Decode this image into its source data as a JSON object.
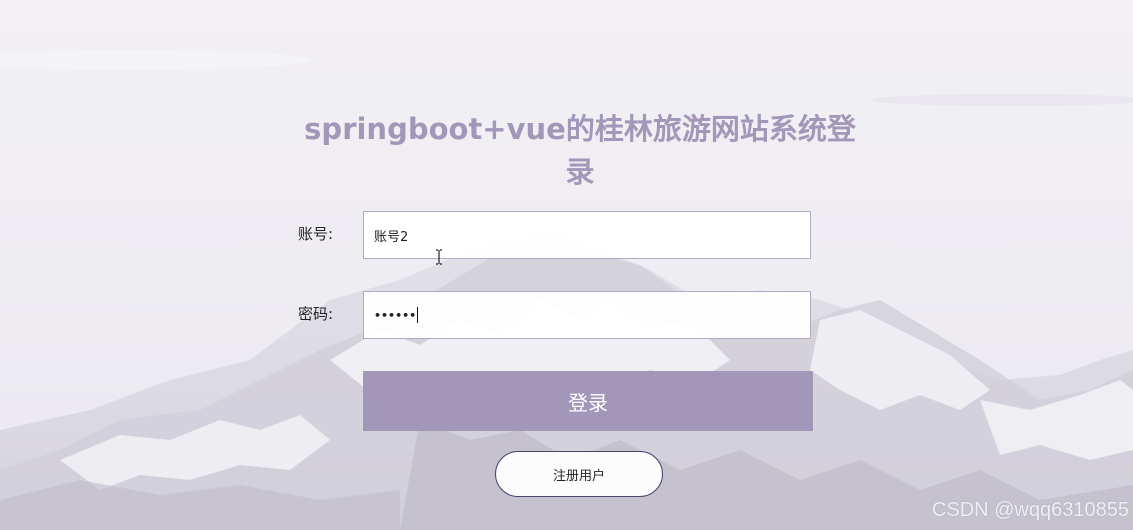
{
  "page": {
    "title": "springboot+vue的桂林旅游网站系统登录"
  },
  "form": {
    "username_label": "账号:",
    "username_value": "账号2",
    "password_label": "密码:",
    "password_value": "••••••",
    "login_label": "登录",
    "register_label": "注册用户"
  },
  "watermark": {
    "text": "CSDN @wqq6310855"
  },
  "colors": {
    "accent": "#a397b9",
    "input_border": "#b2a8c8",
    "register_border": "#4a4270"
  },
  "icons": {
    "text_cursor": "i-beam-cursor-icon"
  }
}
